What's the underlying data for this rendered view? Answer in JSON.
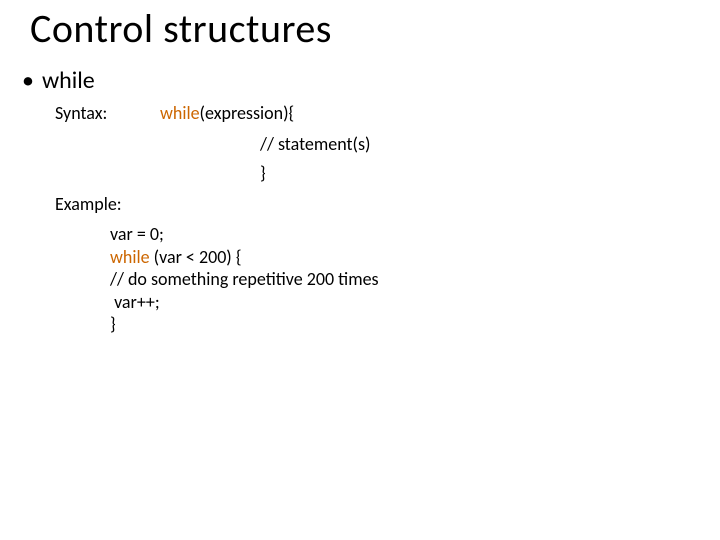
{
  "title": "Control structures",
  "bullet": {
    "marker": "•",
    "text": "while"
  },
  "syntax": {
    "label": "Syntax:",
    "kw": "while",
    "line1_rest": "(expression){",
    "line2": "// statement(s)",
    "line3": "}"
  },
  "example": {
    "label": "Example:",
    "code": {
      "l1": "var = 0;",
      "l2_kw": "while",
      "l2_rest": " (var < 200) {",
      "l3": "// do something repetitive 200 times",
      "l4": " var++;",
      "l5": "}"
    }
  }
}
